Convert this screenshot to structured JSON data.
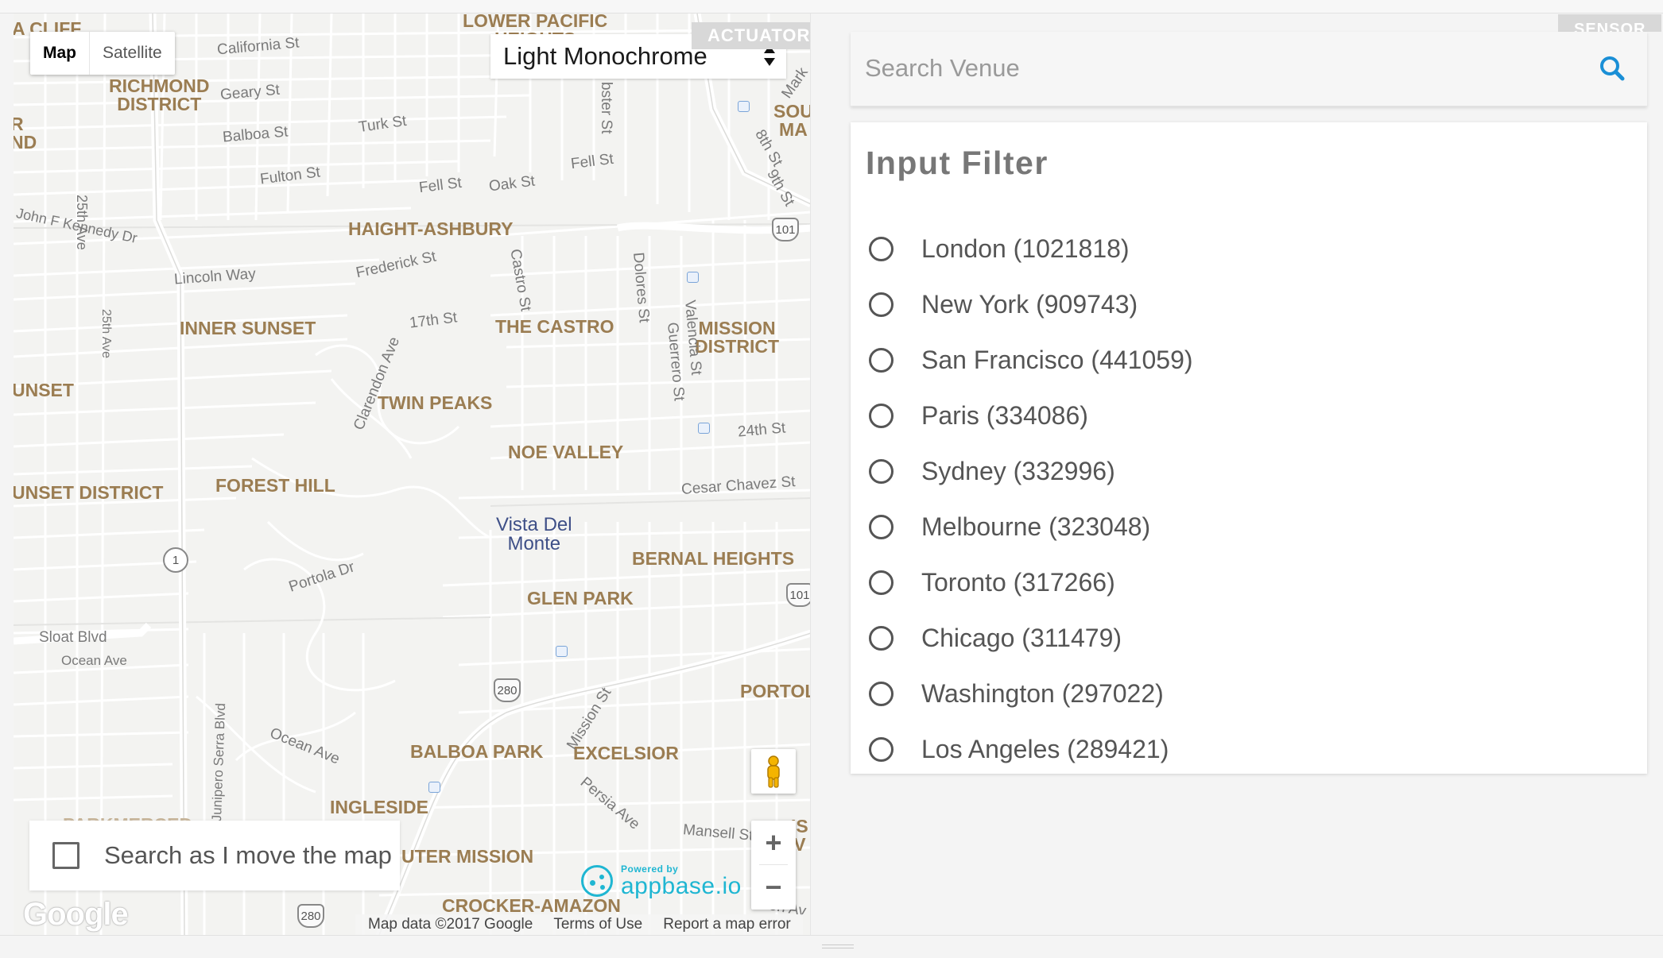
{
  "map": {
    "type_buttons": {
      "map": "Map",
      "satellite": "Satellite"
    },
    "style_selector": {
      "selected": "Light Monochrome"
    },
    "neighborhoods": [
      "RICHMOND\nDISTRICT",
      "HAIGHT-ASHBURY",
      "INNER SUNSET",
      "THE CASTRO",
      "MISSION\nDISTRICT",
      "TWIN PEAKS",
      "NOE VALLEY",
      "FOREST HILL",
      "BERNAL HEIGHTS",
      "GLEN PARK",
      "BALBOA PARK",
      "EXCELSIOR",
      "INGLESIDE",
      "UTER MISSION",
      "CROCKER-AMAZON",
      "UNSET",
      "UNSET DISTRICT",
      "PORTOL",
      "SOU\nMA",
      "A CLIFF",
      "LOWER PACIFIC\nHEIGHTS",
      "R\nND",
      "PARKMERCED",
      "IS\nV"
    ],
    "streets": [
      "California St",
      "Geary St",
      "Balboa St",
      "Turk St",
      "Fulton St",
      "Fell St",
      "Oak St",
      "Fell St",
      "John F Kennedy Dr",
      "Lincoln Way",
      "Frederick St",
      "17th St",
      "Castro St",
      "Dolores St",
      "Valencia St",
      "Guerrero St",
      "24th St",
      "Cesar Chavez St",
      "Clarendon Ave",
      "Portola Dr",
      "Sloat Blvd",
      "Ocean Ave",
      "Ocean Ave",
      "Junipero Serra Blvd",
      "Mission St",
      "Persia Ave",
      "Mansell St",
      "25th Ave",
      "25th Ave",
      "8th St",
      "9th St",
      "bster St",
      "Mark",
      "on Av"
    ],
    "poi": "Vista Del\nMonte",
    "highways": [
      "101",
      "101",
      "280",
      "280",
      "1"
    ],
    "search_as_move_label": "Search as I move the map",
    "search_as_move_checked": false,
    "zoom_in": "+",
    "zoom_out": "−",
    "google_logo": "Google",
    "attribution": {
      "data": "Map data ©2017 Google",
      "terms": "Terms of Use",
      "report": "Report a map error"
    },
    "powered_by": {
      "small": "Powered by",
      "name": "appbase.io"
    },
    "icons": [
      "pegman-icon",
      "appbase-logo-icon"
    ]
  },
  "tags": {
    "actuator": "ACTUATOR",
    "sensor": "SENSOR"
  },
  "search": {
    "placeholder": "Search Venue",
    "value": "",
    "icon": "search-icon"
  },
  "filter": {
    "title": "Input Filter",
    "items": [
      {
        "label": "London (1021818)",
        "selected": false
      },
      {
        "label": "New York (909743)",
        "selected": false
      },
      {
        "label": "San Francisco (441059)",
        "selected": false
      },
      {
        "label": "Paris (334086)",
        "selected": false
      },
      {
        "label": "Sydney (332996)",
        "selected": false
      },
      {
        "label": "Melbourne (323048)",
        "selected": false
      },
      {
        "label": "Toronto (317266)",
        "selected": false
      },
      {
        "label": "Chicago (311479)",
        "selected": false
      },
      {
        "label": "Washington (297022)",
        "selected": false
      },
      {
        "label": "Los Angeles (289421)",
        "selected": false
      }
    ]
  },
  "colors": {
    "accent": "#1a8fd6",
    "neighborhood_label": "#9b7d52",
    "appbase": "#1fb6d2",
    "tag_bg": "#d8d8d8"
  }
}
